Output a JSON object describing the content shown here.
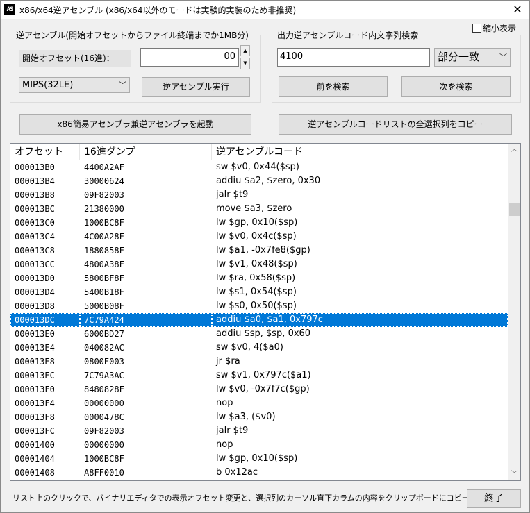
{
  "window": {
    "icon_text": "AS",
    "title": "x86/x64逆アセンブル (x86/x64以外のモードは実験的実装のため非推奨)",
    "close_glyph": "✕"
  },
  "shrink_checkbox": {
    "label": "縮小表示",
    "checked": false
  },
  "disasm_group": {
    "label": "逆アセンブル(開始オフセットからファイル終端までか1MB分)",
    "start_offset_label": "開始オフセット(16進)：",
    "start_offset_value": "00",
    "spin_up": "▲",
    "spin_down": "▼",
    "mode_value": "MIPS(32LE)",
    "combo_arrow": "﹀",
    "run_button": "逆アセンブル実行"
  },
  "search_group": {
    "label": "出力逆アセンブルコード内文字列検索",
    "search_value": "4100",
    "match_mode_value": "部分一致",
    "combo_arrow": "﹀",
    "prev_button": "前を検索",
    "next_button": "次を検索"
  },
  "launch_button": "x86簡易アセンブラ兼逆アセンブラを起動",
  "copy_button": "逆アセンブルコードリストの全選択列をコピー",
  "list": {
    "columns": [
      "オフセット",
      "16進ダンプ",
      "逆アセンブルコード"
    ],
    "selected_index": 11,
    "rows": [
      [
        "000013B0",
        "4400A2AF",
        "sw $v0, 0x44($sp)"
      ],
      [
        "000013B4",
        "30000624",
        "addiu $a2, $zero, 0x30"
      ],
      [
        "000013B8",
        "09F82003",
        "jalr $t9"
      ],
      [
        "000013BC",
        "21380000",
        "move $a3, $zero"
      ],
      [
        "000013C0",
        "1000BC8F",
        "lw $gp, 0x10($sp)"
      ],
      [
        "000013C4",
        "4C00A28F",
        "lw $v0, 0x4c($sp)"
      ],
      [
        "000013C8",
        "1880858F",
        "lw $a1, -0x7fe8($gp)"
      ],
      [
        "000013CC",
        "4800A38F",
        "lw $v1, 0x48($sp)"
      ],
      [
        "000013D0",
        "5800BF8F",
        "lw $ra, 0x58($sp)"
      ],
      [
        "000013D4",
        "5400B18F",
        "lw $s1, 0x54($sp)"
      ],
      [
        "000013D8",
        "5000B08F",
        "lw $s0, 0x50($sp)"
      ],
      [
        "000013DC",
        "7C79A424",
        "addiu $a0, $a1, 0x797c"
      ],
      [
        "000013E0",
        "6000BD27",
        "addiu $sp, $sp, 0x60"
      ],
      [
        "000013E4",
        "040082AC",
        "sw $v0, 4($a0)"
      ],
      [
        "000013E8",
        "0800E003",
        "jr $ra"
      ],
      [
        "000013EC",
        "7C79A3AC",
        "sw $v1, 0x797c($a1)"
      ],
      [
        "000013F0",
        "8480828F",
        "lw $v0, -0x7f7c($gp)"
      ],
      [
        "000013F4",
        "00000000",
        "nop"
      ],
      [
        "000013F8",
        "0000478C",
        "lw $a3, ($v0)"
      ],
      [
        "000013FC",
        "09F82003",
        "jalr $t9"
      ],
      [
        "00001400",
        "00000000",
        "nop"
      ],
      [
        "00001404",
        "1000BC8F",
        "lw $gp, 0x10($sp)"
      ],
      [
        "00001408",
        "A8FF0010",
        "b 0x12ac"
      ]
    ],
    "scroll_up": "︿",
    "scroll_down": "﹀"
  },
  "status_text": "リスト上のクリックで、バイナリエディタでの表示オフセット変更と、選択列のカーソル直下カラムの内容をクリップボードにコピー",
  "exit_button": "終了",
  "colors": {
    "selection": "#0078d7",
    "window_bg": "#f0f0f0"
  }
}
